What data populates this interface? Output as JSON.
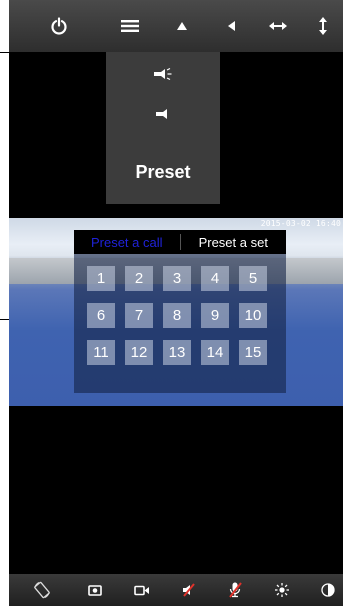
{
  "top_toolbar": {
    "items": [
      {
        "name": "power-icon"
      },
      {
        "name": "preset-menu-icon"
      },
      {
        "name": "tilt-up-icon"
      },
      {
        "name": "pan-left-icon"
      },
      {
        "name": "horizontal-scan-icon"
      },
      {
        "name": "vertical-scan-icon"
      }
    ]
  },
  "dropdown_menu": {
    "items": [
      {
        "name": "light-on-icon"
      },
      {
        "name": "light-off-icon"
      }
    ],
    "preset_label": "Preset"
  },
  "video": {
    "timestamp": "2015-03-02 16:40"
  },
  "preset_panel": {
    "tab_call": "Preset a call",
    "tab_set": "Preset a set",
    "active_tab": "Preset a call",
    "numbers": [
      "1",
      "2",
      "3",
      "4",
      "5",
      "6",
      "7",
      "8",
      "9",
      "10",
      "11",
      "12",
      "13",
      "14",
      "15"
    ]
  },
  "bottom_toolbar": {
    "items": [
      {
        "name": "rotate-icon"
      },
      {
        "name": "snapshot-icon"
      },
      {
        "name": "record-video-icon"
      },
      {
        "name": "speaker-muted-icon"
      },
      {
        "name": "microphone-muted-icon"
      },
      {
        "name": "brightness-icon"
      },
      {
        "name": "contrast-icon"
      }
    ]
  },
  "colors": {
    "active_tab": "#1f22d8",
    "toolbar_bg": "#3a3a3a",
    "muted_red": "#e0322b"
  }
}
